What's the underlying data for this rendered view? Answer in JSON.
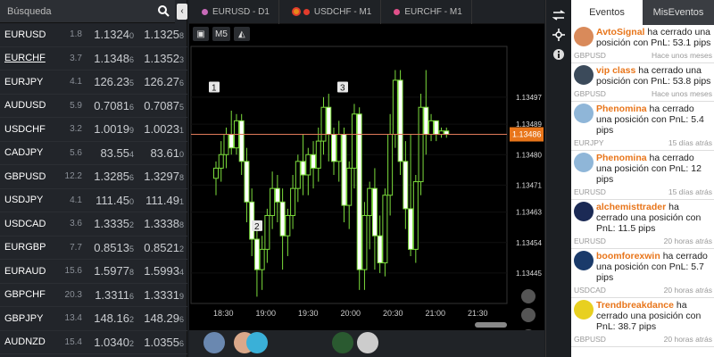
{
  "search": {
    "placeholder": "Búsqueda"
  },
  "pairs": [
    {
      "symbol": "EURUSD",
      "spread": "1.8",
      "bid_main": "1.1324",
      "bid_pip": "0",
      "ask_main": "1.1325",
      "ask_pip": "8",
      "underline": false
    },
    {
      "symbol": "EURCHF",
      "spread": "3.7",
      "bid_main": "1.1348",
      "bid_pip": "6",
      "ask_main": "1.1352",
      "ask_pip": "3",
      "underline": true
    },
    {
      "symbol": "EURJPY",
      "spread": "4.1",
      "bid_main": "126.23",
      "bid_pip": "5",
      "ask_main": "126.27",
      "ask_pip": "6",
      "underline": false
    },
    {
      "symbol": "AUDUSD",
      "spread": "5.9",
      "bid_main": "0.7081",
      "bid_pip": "6",
      "ask_main": "0.7087",
      "ask_pip": "5",
      "underline": false
    },
    {
      "symbol": "USDCHF",
      "spread": "3.2",
      "bid_main": "1.0019",
      "bid_pip": "9",
      "ask_main": "1.0023",
      "ask_pip": "1",
      "underline": false
    },
    {
      "symbol": "CADJPY",
      "spread": "5.6",
      "bid_main": "83.55",
      "bid_pip": "4",
      "ask_main": "83.61",
      "ask_pip": "0",
      "underline": false
    },
    {
      "symbol": "GBPUSD",
      "spread": "12.2",
      "bid_main": "1.3285",
      "bid_pip": "6",
      "ask_main": "1.3297",
      "ask_pip": "8",
      "underline": false
    },
    {
      "symbol": "USDJPY",
      "spread": "4.1",
      "bid_main": "111.45",
      "bid_pip": "0",
      "ask_main": "111.49",
      "ask_pip": "1",
      "underline": false
    },
    {
      "symbol": "USDCAD",
      "spread": "3.6",
      "bid_main": "1.3335",
      "bid_pip": "2",
      "ask_main": "1.3338",
      "ask_pip": "8",
      "underline": false
    },
    {
      "symbol": "EURGBP",
      "spread": "7.7",
      "bid_main": "0.8513",
      "bid_pip": "5",
      "ask_main": "0.8521",
      "ask_pip": "2",
      "underline": false
    },
    {
      "symbol": "EURAUD",
      "spread": "15.6",
      "bid_main": "1.5977",
      "bid_pip": "8",
      "ask_main": "1.5993",
      "ask_pip": "4",
      "underline": false
    },
    {
      "symbol": "GBPCHF",
      "spread": "20.3",
      "bid_main": "1.3311",
      "bid_pip": "6",
      "ask_main": "1.3331",
      "ask_pip": "9",
      "underline": false
    },
    {
      "symbol": "GBPJPY",
      "spread": "13.4",
      "bid_main": "148.16",
      "bid_pip": "2",
      "ask_main": "148.29",
      "ask_pip": "6",
      "underline": false
    },
    {
      "symbol": "AUDNZD",
      "spread": "15.4",
      "bid_main": "1.0340",
      "bid_pip": "2",
      "ask_main": "1.0355",
      "ask_pip": "6",
      "underline": false
    }
  ],
  "tabs": [
    {
      "label": "EURUSD - D1",
      "color": "#c86ab8"
    },
    {
      "label": "USDCHF - M1",
      "color": "#e23c2c"
    },
    {
      "label": "EURCHF - M1",
      "color": "#e0508a"
    }
  ],
  "toolbar": {
    "timeframe": "M5"
  },
  "chart_data": {
    "type": "candlestick",
    "symbol": "EURCHF",
    "timeframe": "M1",
    "x_ticks": [
      "18:30",
      "19:00",
      "19:30",
      "20:00",
      "20:30",
      "21:00",
      "21:30"
    ],
    "y_ticks": [
      1.13497,
      1.13489,
      1.1348,
      1.13471,
      1.13463,
      1.13454,
      1.13445
    ],
    "ylim": [
      1.13436,
      1.13512
    ],
    "current_price": "1.13486",
    "markers": [
      "1",
      "2",
      "3"
    ],
    "candles": [
      [
        1.13473,
        1.13476,
        1.13468,
        1.13478
      ],
      [
        1.13476,
        1.1348,
        1.13472,
        1.13484
      ],
      [
        1.1348,
        1.13486,
        1.13476,
        1.13488
      ],
      [
        1.13486,
        1.13482,
        1.1348,
        1.13493
      ],
      [
        1.13482,
        1.1349,
        1.1348,
        1.13492
      ],
      [
        1.1349,
        1.13478,
        1.13474,
        1.13492
      ],
      [
        1.13478,
        1.13466,
        1.1346,
        1.13482
      ],
      [
        1.13466,
        1.13455,
        1.1345,
        1.1347
      ],
      [
        1.13455,
        1.13446,
        1.13438,
        1.1346
      ],
      [
        1.13446,
        1.13452,
        1.1344,
        1.13456
      ],
      [
        1.13452,
        1.13462,
        1.13448,
        1.13464
      ],
      [
        1.13462,
        1.1347,
        1.13458,
        1.13475
      ],
      [
        1.1347,
        1.13466,
        1.1346,
        1.13474
      ],
      [
        1.13466,
        1.13456,
        1.13446,
        1.1347
      ],
      [
        1.13456,
        1.13462,
        1.1345,
        1.13464
      ],
      [
        1.13462,
        1.1347,
        1.13458,
        1.13474
      ],
      [
        1.1347,
        1.13478,
        1.13466,
        1.1348
      ],
      [
        1.13478,
        1.13474,
        1.13468,
        1.13486
      ],
      [
        1.13474,
        1.1348,
        1.13468,
        1.13482
      ],
      [
        1.1348,
        1.13476,
        1.1347,
        1.13484
      ],
      [
        1.13476,
        1.13484,
        1.13472,
        1.13488
      ],
      [
        1.13484,
        1.13494,
        1.1348,
        1.13497
      ],
      [
        1.13494,
        1.13486,
        1.13478,
        1.13498
      ],
      [
        1.13486,
        1.13478,
        1.13474,
        1.13488
      ],
      [
        1.13478,
        1.13486,
        1.13472,
        1.1349
      ],
      [
        1.13486,
        1.13465,
        1.1346,
        1.13488
      ],
      [
        1.13465,
        1.13476,
        1.13458,
        1.13478
      ],
      [
        1.13476,
        1.13492,
        1.1347,
        1.13495
      ],
      [
        1.13492,
        1.13446,
        1.1344,
        1.13494
      ],
      [
        1.13446,
        1.13462,
        1.1344,
        1.13466
      ],
      [
        1.13462,
        1.1347,
        1.13452,
        1.13472
      ],
      [
        1.1347,
        1.13456,
        1.13446,
        1.13476
      ],
      [
        1.13456,
        1.13448,
        1.13445,
        1.13462
      ],
      [
        1.13448,
        1.13468,
        1.13444,
        1.1347
      ],
      [
        1.13468,
        1.13486,
        1.13462,
        1.13492
      ],
      [
        1.13486,
        1.13502,
        1.13482,
        1.13505
      ],
      [
        1.13502,
        1.13478,
        1.13474,
        1.13505
      ],
      [
        1.13478,
        1.13464,
        1.13458,
        1.13484
      ],
      [
        1.13464,
        1.13452,
        1.1345,
        1.13486
      ],
      [
        1.13452,
        1.13472,
        1.13448,
        1.13474
      ],
      [
        1.13472,
        1.13494,
        1.13468,
        1.13498
      ],
      [
        1.13494,
        1.13486,
        1.1348,
        1.13505
      ],
      [
        1.13486,
        1.1349,
        1.13484,
        1.13492
      ],
      [
        1.1349,
        1.13486,
        1.13484,
        1.13488
      ],
      [
        1.13486,
        1.13487,
        1.13485,
        1.13488
      ],
      [
        1.13487,
        1.13486,
        1.13485,
        1.13488
      ]
    ]
  },
  "events_tabs": {
    "active": "Eventos",
    "inactive": "MisEventos"
  },
  "events": [
    {
      "user": "AvtoSignal",
      "text": "ha cerrado una posición con PnL: 53.1 pips",
      "symbol": "GBPUSD",
      "time": "Hace unos meses",
      "pic": "#d98a5a"
    },
    {
      "user": "vip class",
      "text": "ha cerrado una posición con PnL: 53.8 pips",
      "symbol": "GBPUSD",
      "time": "Hace unos meses",
      "pic": "#3b4a5a"
    },
    {
      "user": "Phenomina",
      "text": "ha cerrado una posición con PnL: 5.4 pips",
      "symbol": "EURJPY",
      "time": "15 días atrás",
      "pic": "#8fb6d8"
    },
    {
      "user": "Phenomina",
      "text": "ha cerrado una posición con PnL: 12 pips",
      "symbol": "EURUSD",
      "time": "15 días atrás",
      "pic": "#8fb6d8"
    },
    {
      "user": "alchemisttrader",
      "text": "ha cerrado una posición con PnL: 11.5 pips",
      "symbol": "EURUSD",
      "time": "20 horas atrás",
      "pic": "#1b2a55"
    },
    {
      "user": "boomforexwin",
      "text": "ha cerrado una posición con PnL: 5.7 pips",
      "symbol": "USDCAD",
      "time": "20 horas atrás",
      "pic": "#1a3a6a"
    },
    {
      "user": "Trendbreakdance",
      "text": "ha cerrado una posición con PnL: 38.7 pips",
      "symbol": "GBPUSD",
      "time": "20 horas atrás",
      "pic": "#e8d020"
    }
  ]
}
